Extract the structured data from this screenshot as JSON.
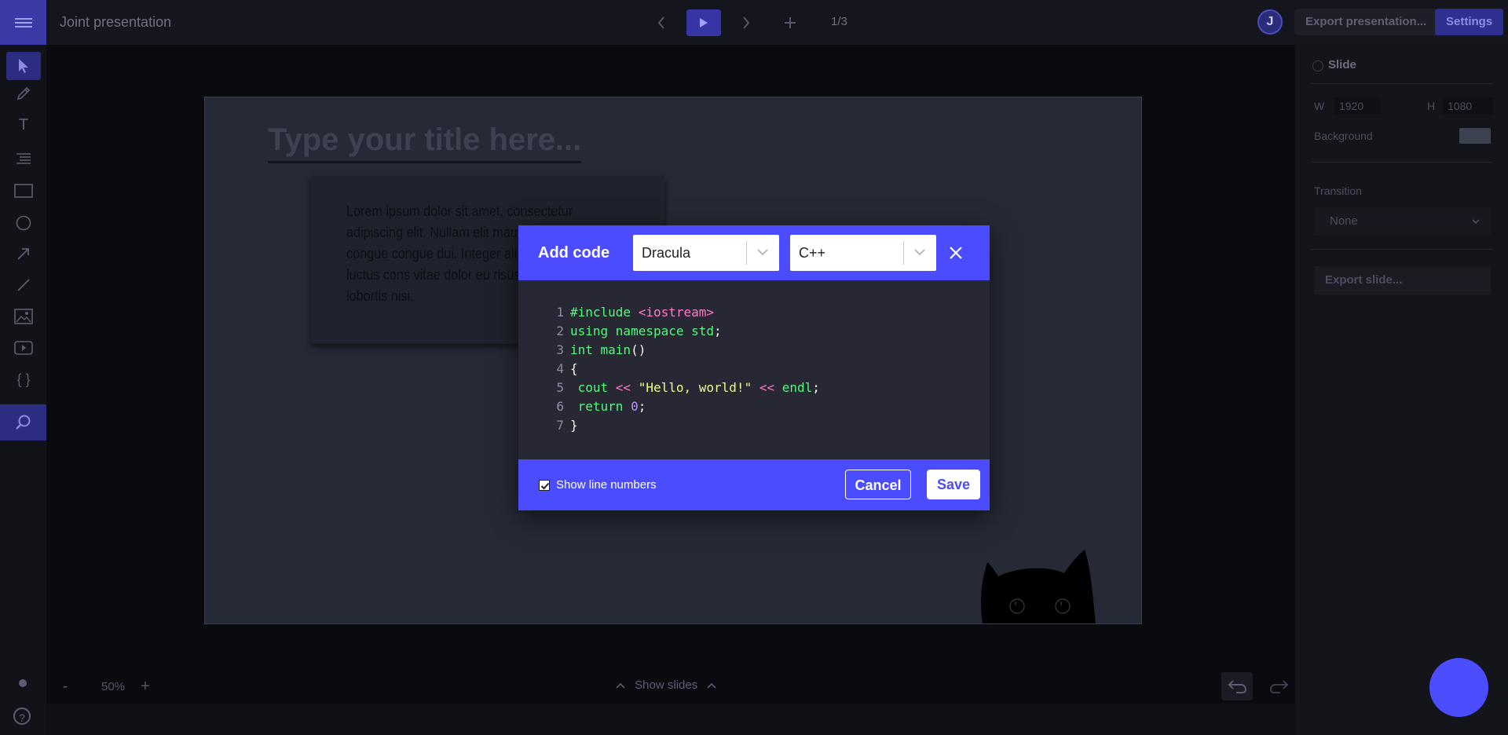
{
  "app": {
    "title": "Joint presentation",
    "page_indicator": "1/3",
    "avatar_letter": "J",
    "export_presentation_label": "Export presentation...",
    "settings_label": "Settings"
  },
  "toolbar": {
    "tools": [
      "select-icon",
      "pencil-icon",
      "text-icon",
      "list-icon",
      "rectangle-icon",
      "circle-icon",
      "arrow-icon",
      "line-icon",
      "image-icon",
      "video-icon",
      "code-icon"
    ],
    "code_glyph": "{ }",
    "text_glyph": "T",
    "help_glyph": "?"
  },
  "slide": {
    "title_placeholder": "Type your title here...",
    "body_text": "Lorem ipsum dolor sit amet, consectetur adipiscing elit. Nullam elit mauris, tristique vitae congue congue dui. Integer ali rutrum. Vestibulum luctus cons vitae dolor eu risus ullamcorpe amet lobortis nisi."
  },
  "zoom": {
    "minus": "-",
    "level": "50%",
    "plus": "+"
  },
  "bottom": {
    "show_slides_label": "Show slides"
  },
  "properties": {
    "section_title": "Slide",
    "width_label": "W",
    "width_value": "1920",
    "height_label": "H",
    "height_value": "1080",
    "background_label": "Background",
    "transition_label": "Transition",
    "transition_value": "None",
    "export_slide_label": "Export slide..."
  },
  "modal": {
    "title": "Add code",
    "theme_value": "Dracula",
    "language_value": "C++",
    "show_line_numbers_label": "Show line numbers",
    "show_line_numbers_checked": true,
    "cancel_label": "Cancel",
    "save_label": "Save",
    "code_lines": [
      {
        "n": "1",
        "tokens": [
          [
            "kw",
            "#include "
          ],
          [
            "pink",
            "<iostream>"
          ]
        ]
      },
      {
        "n": "2",
        "tokens": [
          [
            "kw",
            "using namespace std"
          ],
          [
            "plain",
            ";"
          ]
        ]
      },
      {
        "n": "3",
        "tokens": [
          [
            "kw",
            "int main"
          ],
          [
            "plain",
            "()"
          ]
        ]
      },
      {
        "n": "4",
        "tokens": [
          [
            "plain",
            "{"
          ]
        ]
      },
      {
        "n": "5",
        "tokens": [
          [
            "kw",
            " cout "
          ],
          [
            "pink",
            "<<"
          ],
          [
            "plain",
            " "
          ],
          [
            "str",
            "\"Hello, world!\""
          ],
          [
            "plain",
            " "
          ],
          [
            "pink",
            "<<"
          ],
          [
            "kw",
            " endl"
          ],
          [
            "plain",
            ";"
          ]
        ]
      },
      {
        "n": "6",
        "tokens": [
          [
            "kw",
            " return "
          ],
          [
            "num",
            "0"
          ],
          [
            "plain",
            ";"
          ]
        ]
      },
      {
        "n": "7",
        "tokens": [
          [
            "plain",
            "}"
          ]
        ]
      }
    ]
  },
  "colors": {
    "accent": "#4b4bff",
    "modal_body": "#272833",
    "fab": "#4c4dff"
  }
}
